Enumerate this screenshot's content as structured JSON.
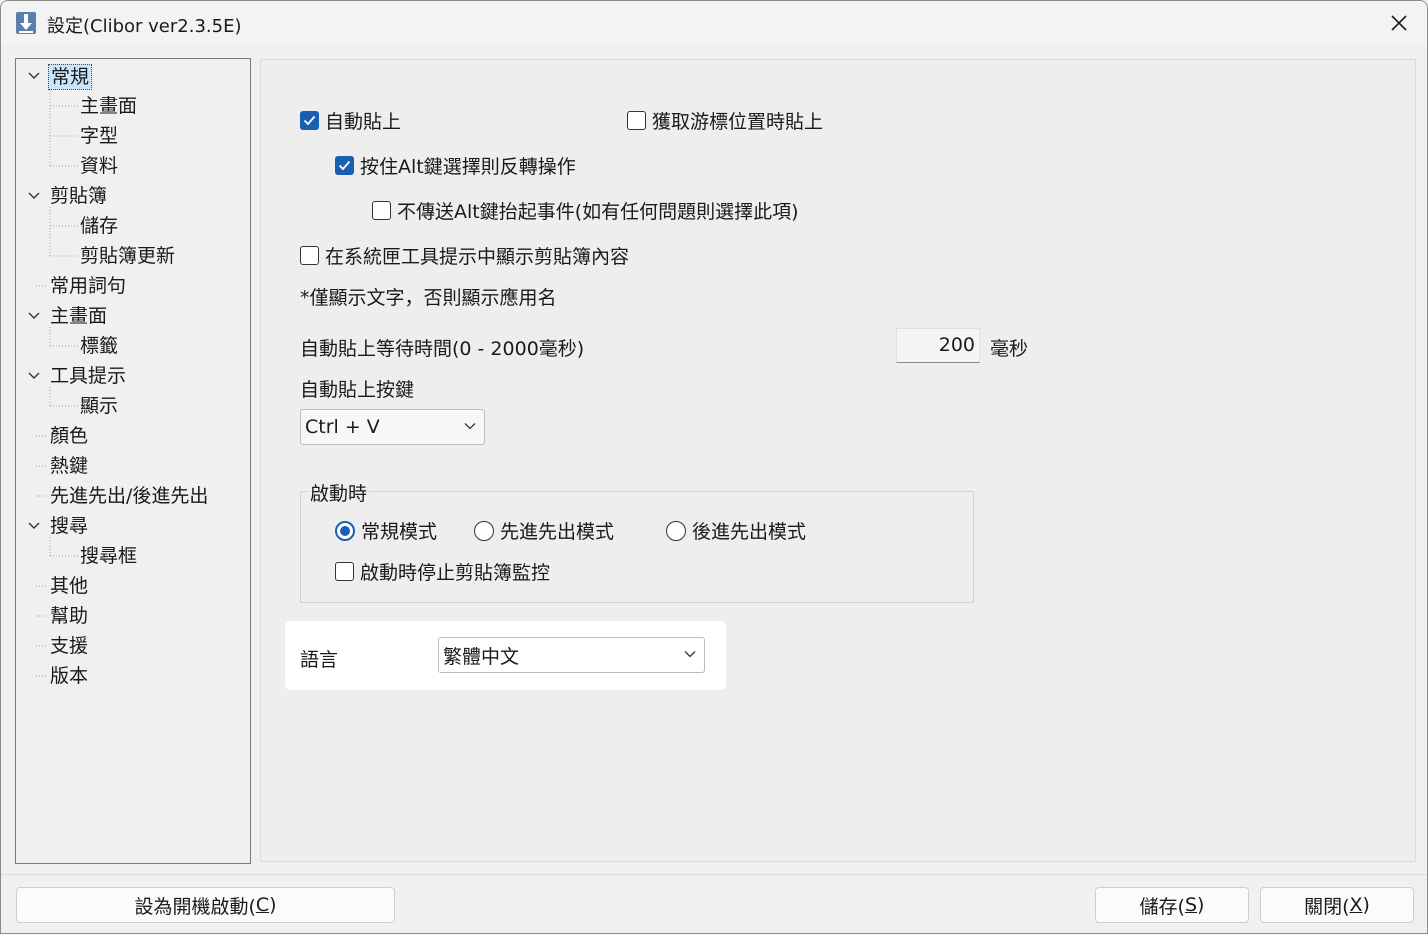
{
  "window": {
    "title": "設定(Clibor ver2.3.5E)"
  },
  "tree": {
    "items": [
      {
        "label": "常規"
      },
      {
        "label": "主畫面"
      },
      {
        "label": "字型"
      },
      {
        "label": "資料"
      },
      {
        "label": "剪貼簿"
      },
      {
        "label": "儲存"
      },
      {
        "label": "剪貼簿更新"
      },
      {
        "label": "常用詞句"
      },
      {
        "label": "主畫面"
      },
      {
        "label": "標籤"
      },
      {
        "label": "工具提示"
      },
      {
        "label": "顯示"
      },
      {
        "label": "顏色"
      },
      {
        "label": "熱鍵"
      },
      {
        "label": "先進先出/後進先出"
      },
      {
        "label": "搜尋"
      },
      {
        "label": "搜尋框"
      },
      {
        "label": "其他"
      },
      {
        "label": "幫助"
      },
      {
        "label": "支援"
      },
      {
        "label": "版本"
      }
    ]
  },
  "settings": {
    "auto_paste": "自動貼上",
    "paste_on_cursor": "獲取游標位置時貼上",
    "alt_reverse": "按住Alt鍵選擇則反轉操作",
    "no_alt_up": "不傳送Alt鍵抬起事件(如有任何問題則選擇此項)",
    "tray_tooltip": "在系統匣工具提示中顯示剪貼簿內容",
    "tray_note": "*僅顯示文字，否則顯示應用名",
    "wait_label": "自動貼上等待時間(0 - 2000毫秒)",
    "wait_value": "200",
    "wait_unit": "毫秒",
    "paste_key_label": "自動貼上按鍵",
    "paste_key_value": "Ctrl + V"
  },
  "startup": {
    "title": "啟動時",
    "mode_normal": "常規模式",
    "mode_fifo": "先進先出模式",
    "mode_lifo": "後進先出模式",
    "stop_monitor": "啟動時停止剪貼簿監控"
  },
  "language": {
    "label": "語言",
    "value": "繁體中文"
  },
  "buttons": {
    "startup_main": "設為開機啟動(",
    "startup_key": "C",
    "startup_end": ")",
    "save_main": "儲存(",
    "save_key": "S",
    "save_end": ")",
    "close_main": "關閉(",
    "close_key": "X",
    "close_end": ")"
  },
  "colors": {
    "accent": "#1a5fb4",
    "selection": "#cce4f7"
  }
}
